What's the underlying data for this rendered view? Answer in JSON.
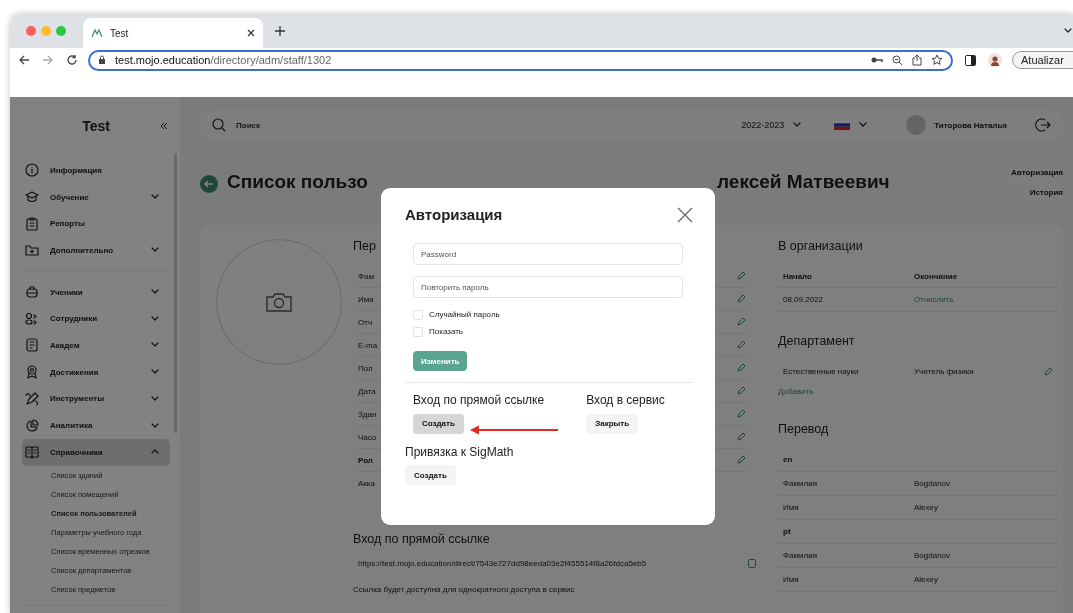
{
  "browser": {
    "tab_title": "Test",
    "url_host": "test.mojo.education",
    "url_path": "/directory/adm/staff/1302",
    "update_button": "Atualizar"
  },
  "sidebar": {
    "logo": "Test",
    "sections": [
      {
        "items": [
          {
            "label": "Информация",
            "kind": "link",
            "selected": false
          },
          {
            "label": "Обучение",
            "kind": "group",
            "expanded": false,
            "selected": false
          },
          {
            "label": "Репорты",
            "kind": "link",
            "selected": false
          },
          {
            "label": "Дополнительно",
            "kind": "group",
            "expanded": false,
            "selected": false
          }
        ]
      },
      {
        "items": [
          {
            "label": "Ученики",
            "kind": "group",
            "expanded": false,
            "selected": false
          },
          {
            "label": "Сотрудники",
            "kind": "group",
            "expanded": false,
            "selected": false
          },
          {
            "label": "Академ",
            "kind": "group",
            "expanded": false,
            "selected": false
          },
          {
            "label": "Достижения",
            "kind": "group",
            "expanded": false,
            "selected": false
          },
          {
            "label": "Инструменты",
            "kind": "group",
            "expanded": false,
            "selected": false
          },
          {
            "label": "Аналитика",
            "kind": "group",
            "expanded": false,
            "selected": false
          },
          {
            "label": "Справочники",
            "kind": "group",
            "expanded": true,
            "selected": true,
            "children": [
              {
                "label": "Список зданий",
                "selected": false
              },
              {
                "label": "Список помещений",
                "selected": false
              },
              {
                "label": "Список пользователей",
                "selected": true
              },
              {
                "label": "Параметры учебного года",
                "selected": false
              },
              {
                "label": "Список временных отрезков",
                "selected": false
              },
              {
                "label": "Список департаментов",
                "selected": false
              },
              {
                "label": "Список предметов",
                "selected": false
              }
            ]
          }
        ]
      }
    ]
  },
  "header": {
    "search": {
      "placeholder": "Поиск"
    },
    "year": "2022-2023",
    "user_name": "Титорова Наталья"
  },
  "page": {
    "title_parts": [
      "Список пользо",
      "лексей Матвеевич"
    ],
    "actions": [
      "Авторизация",
      "История"
    ]
  },
  "personal": {
    "title": "Пер",
    "fields": [
      {
        "label": "Фам",
        "bold": false,
        "editable": true
      },
      {
        "label": "Имя",
        "bold": false,
        "editable": true
      },
      {
        "label": "Отч",
        "bold": false,
        "editable": true
      },
      {
        "label": "E-ma",
        "bold": false,
        "editable": true
      },
      {
        "label": "Пол",
        "bold": false,
        "editable": true
      },
      {
        "label": "Дата",
        "bold": false,
        "editable": true
      },
      {
        "label": "Здан",
        "bold": false,
        "editable": true
      },
      {
        "label": "Часо",
        "bold": false,
        "editable": true
      },
      {
        "label": "Рол",
        "bold": true,
        "editable": true
      },
      {
        "label": "Акка",
        "bold": false,
        "editable": false
      }
    ]
  },
  "direct_link": {
    "title": "Вход по прямой ссылке",
    "url": "https://test.mojo.education/direct/7543e727dd98eeda03e2f455514f8a26fdca5eb5",
    "note": "Ссылка будет доступна для однократного доступа в сервис"
  },
  "organization": {
    "title": "В организации",
    "columns": [
      "Начало",
      "Окончание"
    ],
    "rows": [
      {
        "start": "08.09.2022",
        "end": "Отчислить"
      }
    ]
  },
  "department": {
    "title": "Департамент",
    "rows": [
      {
        "name": "Естественные науки",
        "position": "Учитель физики"
      }
    ],
    "add": "Добавить"
  },
  "translation": {
    "title": "Перевод",
    "groups": [
      {
        "lang": "en",
        "rows": [
          {
            "label": "Фамилия",
            "value": "Bogdanov"
          },
          {
            "label": "Имя",
            "value": "Alexey"
          }
        ]
      },
      {
        "lang": "pt",
        "rows": [
          {
            "label": "Фамилия",
            "value": "Bogdanov"
          },
          {
            "label": "Имя",
            "value": "Alexey"
          }
        ]
      }
    ]
  },
  "modal": {
    "title": "Авторизация",
    "fields": [
      {
        "placeholder": "Password"
      },
      {
        "placeholder": "Повторить пароль"
      }
    ],
    "checkboxes": [
      {
        "label": "Случайный пароль",
        "checked": false
      },
      {
        "label": "Показать",
        "checked": false
      }
    ],
    "submit": "Изменить",
    "sections": [
      {
        "title": "Вход по прямой ссылке",
        "button": "Создать",
        "highlighted": true
      },
      {
        "title": "Вход в сервис",
        "button": "Закрыть",
        "highlighted": false
      }
    ],
    "sigmath": {
      "title": "Привязка к SigMath",
      "button": "Создать"
    }
  }
}
